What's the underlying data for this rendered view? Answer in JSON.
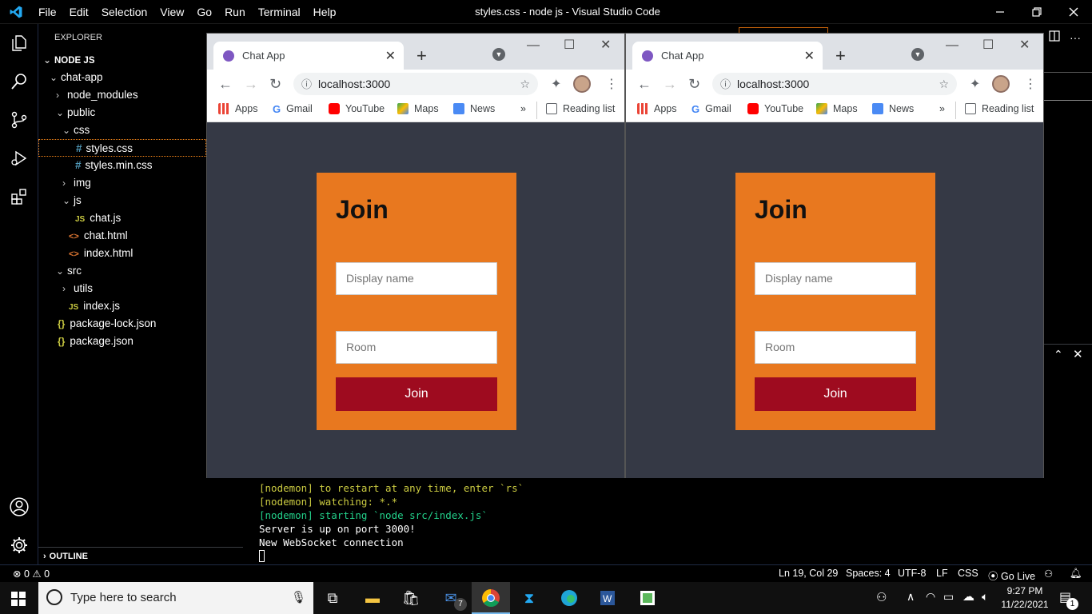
{
  "vscode": {
    "menu": [
      "File",
      "Edit",
      "Selection",
      "View",
      "Go",
      "Run",
      "Terminal",
      "Help"
    ],
    "window_title": "styles.css - node js - Visual Studio Code",
    "explorer": {
      "header": "EXPLORER",
      "root": "NODE JS",
      "items": [
        {
          "label": "chat-app",
          "type": "folder-open",
          "depth": 1
        },
        {
          "label": "node_modules",
          "type": "folder",
          "depth": 2
        },
        {
          "label": "public",
          "type": "folder-open",
          "depth": 2
        },
        {
          "label": "css",
          "type": "folder-open",
          "depth": 3
        },
        {
          "label": "styles.css",
          "type": "css",
          "depth": 4,
          "selected": true
        },
        {
          "label": "styles.min.css",
          "type": "css",
          "depth": 4
        },
        {
          "label": "img",
          "type": "folder",
          "depth": 3
        },
        {
          "label": "js",
          "type": "folder-open",
          "depth": 3
        },
        {
          "label": "chat.js",
          "type": "js",
          "depth": 4
        },
        {
          "label": "chat.html",
          "type": "html",
          "depth": 3
        },
        {
          "label": "index.html",
          "type": "html",
          "depth": 3
        },
        {
          "label": "src",
          "type": "folder-open",
          "depth": 2
        },
        {
          "label": "utils",
          "type": "folder",
          "depth": 3
        },
        {
          "label": "index.js",
          "type": "js",
          "depth": 3
        },
        {
          "label": "package-lock.json",
          "type": "json",
          "depth": 2
        },
        {
          "label": "package.json",
          "type": "json",
          "depth": 2
        }
      ],
      "outline": "OUTLINE"
    },
    "terminal_lines": [
      {
        "text": "[nodemon] to restart at any time, enter `rs`",
        "color": "#cbcb41"
      },
      {
        "text": "[nodemon] watching: *.*",
        "color": "#cbcb41"
      },
      {
        "text": "[nodemon] starting `node src/index.js`",
        "color": "#23d18b"
      },
      {
        "text": "Server is up on port 3000!",
        "color": "#ffffff"
      },
      {
        "text": "New WebSocket connection",
        "color": "#ffffff"
      }
    ],
    "status": {
      "errors": "0",
      "warnings": "0",
      "position": "Ln 19, Col 29",
      "spaces": "Spaces: 4",
      "encoding": "UTF-8",
      "eol": "LF",
      "language": "CSS",
      "golive": "Go Live"
    }
  },
  "browser": {
    "tab_title": "Chat App",
    "url": "localhost:3000",
    "bookmarks": [
      "Apps",
      "Gmail",
      "YouTube",
      "Maps",
      "News"
    ],
    "reading_list": "Reading list",
    "more": "»",
    "join_title": "Join",
    "display_placeholder": "Display name",
    "room_placeholder": "Room",
    "join_button": "Join"
  },
  "taskbar": {
    "search_placeholder": "Type here to search",
    "time": "9:27 PM",
    "date": "11/22/2021",
    "mail_badge": "7",
    "notif_badge": "1"
  },
  "colors": {
    "card": "#e8781f",
    "button": "#9e0b1f",
    "page_bg": "#353945",
    "vscode_blue": "#0078d4"
  }
}
